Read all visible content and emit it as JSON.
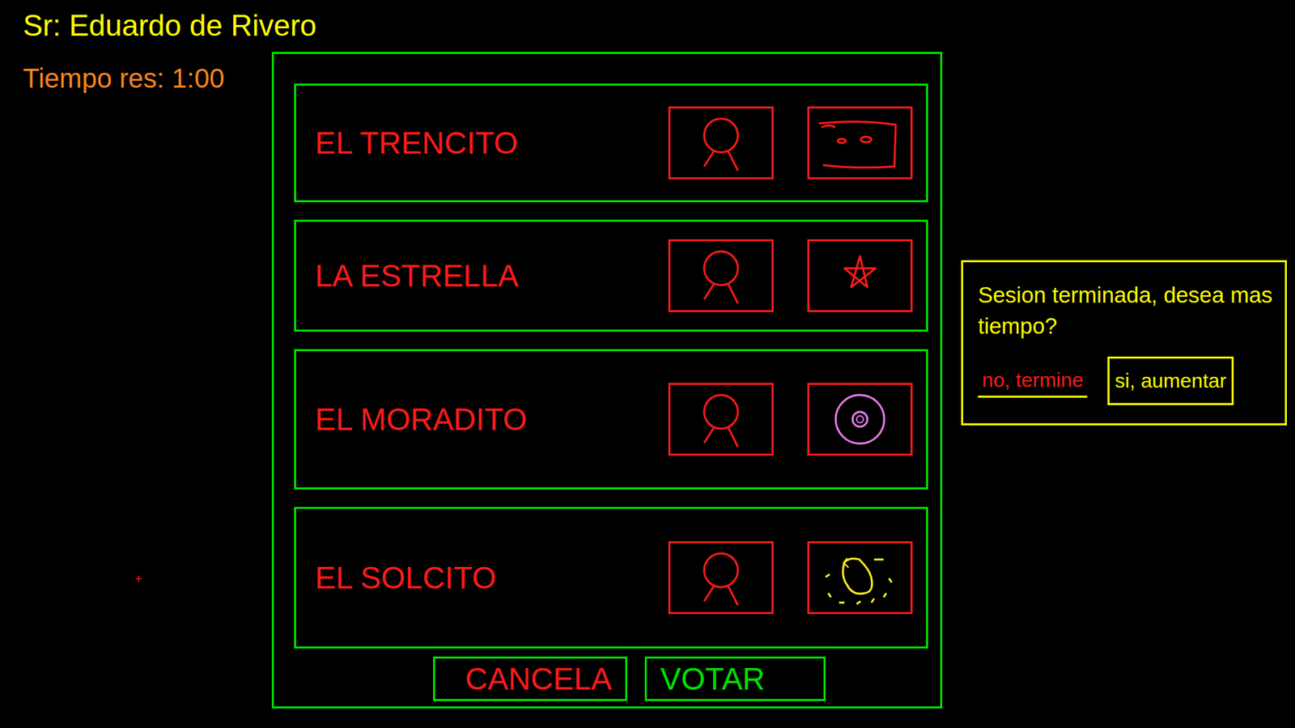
{
  "user": "Sr: Eduardo de Rivero",
  "timer": "Tiempo res: 1:00",
  "cursor": "+",
  "candidates": [
    {
      "name": "EL TRENCITO",
      "kind": "train",
      "color": "#ff1a1a"
    },
    {
      "name": "LA ESTRELLA",
      "kind": "star",
      "color": "#ff1a1a"
    },
    {
      "name": "EL MORADITO",
      "kind": "target",
      "color": "#e87ae8"
    },
    {
      "name": "EL SOLCITO",
      "kind": "sun",
      "color": "#ffee22"
    }
  ],
  "buttons": {
    "cancel": "CANCELA",
    "vote": "VOTAR"
  },
  "dialog": {
    "message": "Sesion terminada, desea mas tiempo?",
    "options": [
      {
        "label": "no, termine",
        "selected": false
      },
      {
        "label": "si, aumentar",
        "selected": true
      }
    ]
  }
}
